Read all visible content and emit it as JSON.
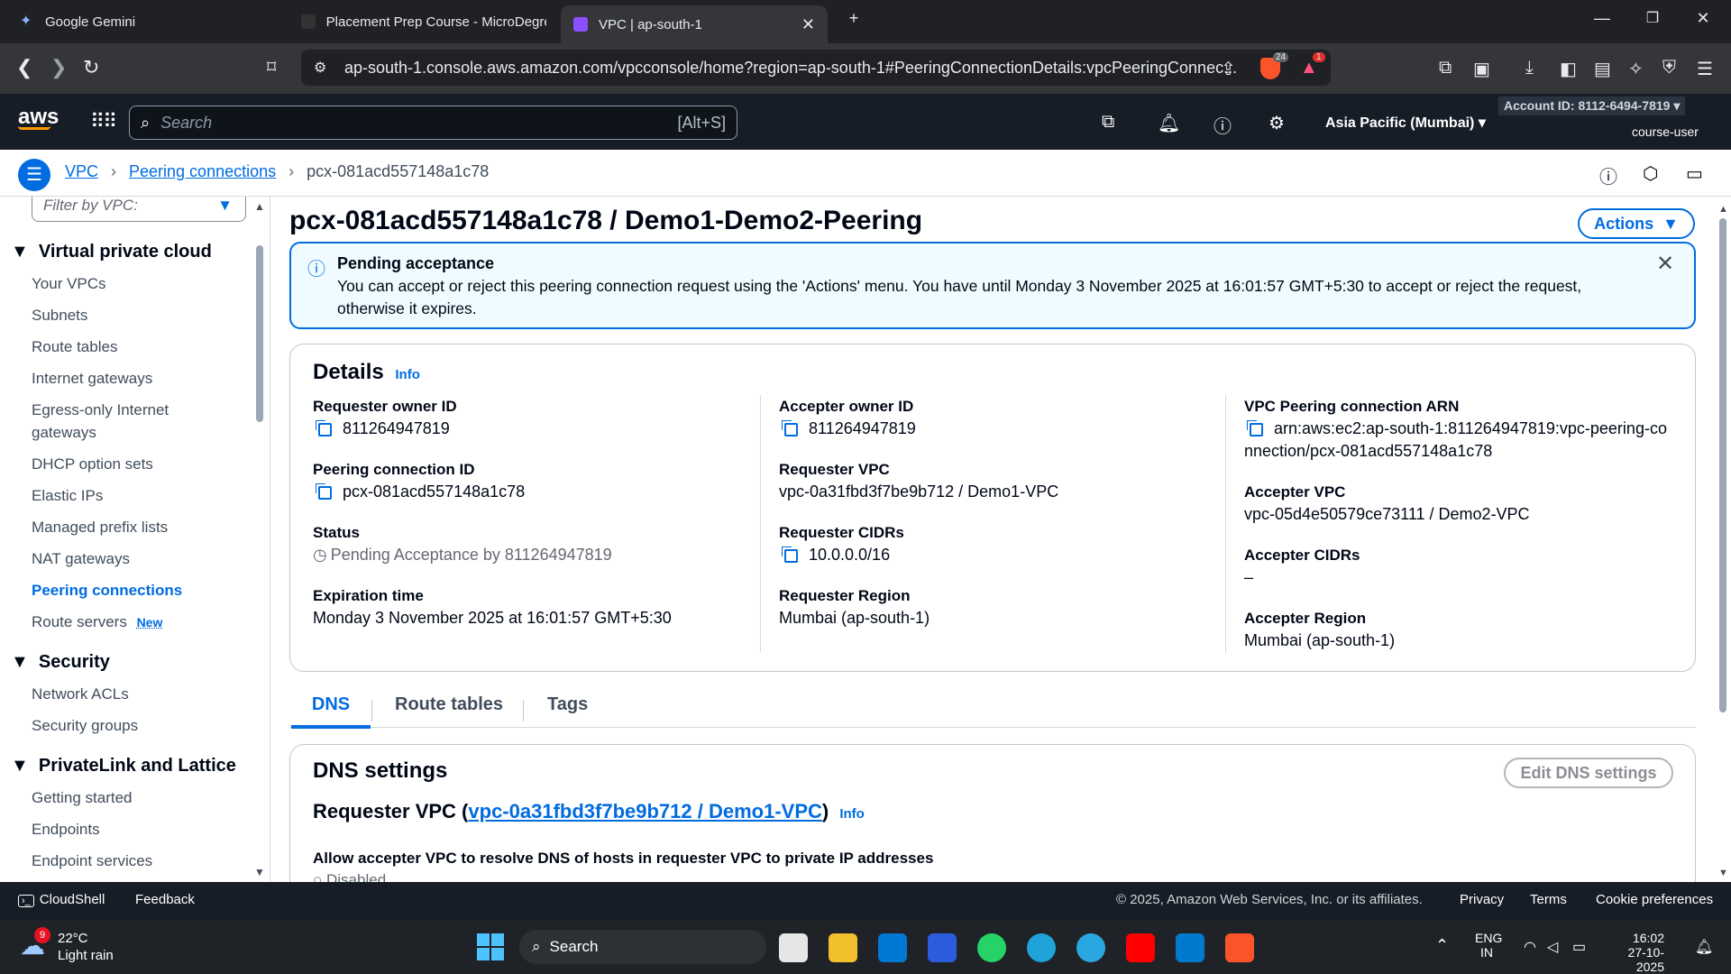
{
  "browser": {
    "tabs": [
      {
        "title": "Google Gemini"
      },
      {
        "title": "Placement Prep Course - MicroDegre"
      },
      {
        "title": "VPC | ap-south-1"
      }
    ],
    "url": "ap-south-1.console.aws.amazon.com/vpcconsole/home?region=ap-south-1#PeeringConnectionDetails:vpcPeeringConnec...",
    "brave_badge": "24",
    "alert_badge": "1"
  },
  "aws_header": {
    "logo": "aws",
    "search_placeholder": "Search",
    "search_shortcut": "[Alt+S]",
    "region": "Asia Pacific (Mumbai)",
    "account": "Account ID: 8112-6494-7819",
    "user": "course-user"
  },
  "breadcrumb": {
    "vpc": "VPC",
    "peering": "Peering connections",
    "current": "pcx-081acd557148a1c78"
  },
  "sidebar": {
    "filter_placeholder": "Filter by VPC:",
    "sections": [
      {
        "title": "Virtual private cloud"
      },
      {
        "title": "Security"
      },
      {
        "title": "PrivateLink and Lattice"
      }
    ],
    "vpc_items": [
      "Your VPCs",
      "Subnets",
      "Route tables",
      "Internet gateways",
      "Egress-only Internet",
      "gateways",
      "DHCP option sets",
      "Elastic IPs",
      "Managed prefix lists",
      "NAT gateways",
      "Peering connections",
      "Route servers"
    ],
    "new_badge": "New",
    "security_items": [
      "Network ACLs",
      "Security groups"
    ],
    "privatelink_items": [
      "Getting started",
      "Endpoints",
      "Endpoint services"
    ]
  },
  "page": {
    "title": "pcx-081acd557148a1c78 / Demo1-Demo2-Peering",
    "actions_label": "Actions",
    "alert": {
      "title": "Pending acceptance",
      "line1": "You can accept or reject this peering connection request using the 'Actions' menu. You have until Monday 3 November 2025 at 16:01:57 GMT+5:30 to accept or reject the request,",
      "line2": "otherwise it expires."
    },
    "details": {
      "heading": "Details",
      "info": "Info",
      "requester_owner_id_label": "Requester owner ID",
      "requester_owner_id": "811264947819",
      "peering_id_label": "Peering connection ID",
      "peering_id": "pcx-081acd557148a1c78",
      "status_label": "Status",
      "status": "Pending Acceptance by 811264947819",
      "expiration_label": "Expiration time",
      "expiration": "Monday 3 November 2025 at 16:01:57 GMT+5:30",
      "accepter_owner_id_label": "Accepter owner ID",
      "accepter_owner_id": "811264947819",
      "requester_vpc_label": "Requester VPC",
      "requester_vpc": "vpc-0a31fbd3f7be9b712 / Demo1-VPC",
      "requester_cidrs_label": "Requester CIDRs",
      "requester_cidrs": "10.0.0.0/16",
      "requester_region_label": "Requester Region",
      "requester_region": "Mumbai (ap-south-1)",
      "arn_label": "VPC Peering connection ARN",
      "arn_line1": "arn:aws:ec2:ap-south-1:811264947819:vpc-peering-co",
      "arn_line2": "nnection/pcx-081acd557148a1c78",
      "accepter_vpc_label": "Accepter VPC",
      "accepter_vpc": "vpc-05d4e50579ce73111 / Demo2-VPC",
      "accepter_cidrs_label": "Accepter CIDRs",
      "accepter_cidrs": "–",
      "accepter_region_label": "Accepter Region",
      "accepter_region": "Mumbai (ap-south-1)"
    },
    "tabs": [
      "DNS",
      "Route tables",
      "Tags"
    ],
    "dns": {
      "heading": "DNS settings",
      "edit_label": "Edit DNS settings",
      "requester_prefix": "Requester VPC (",
      "requester_link": "vpc-0a31fbd3f7be9b712 / Demo1-VPC",
      "requester_suffix": ")",
      "info": "Info",
      "allow_label": "Allow accepter VPC to resolve DNS of hosts in requester VPC to private IP addresses",
      "allow_value": "Disabled"
    }
  },
  "footer": {
    "cloudshell": "CloudShell",
    "feedback": "Feedback",
    "copyright": "© 2025, Amazon Web Services, Inc. or its affiliates.",
    "privacy": "Privacy",
    "terms": "Terms",
    "cookies": "Cookie preferences"
  },
  "taskbar": {
    "weather_temp": "22°C",
    "weather_desc": "Light rain",
    "weather_badge": "9",
    "search": "Search",
    "lang1": "ENG",
    "lang2": "IN",
    "time": "16:02",
    "date": "27-10-2025"
  }
}
